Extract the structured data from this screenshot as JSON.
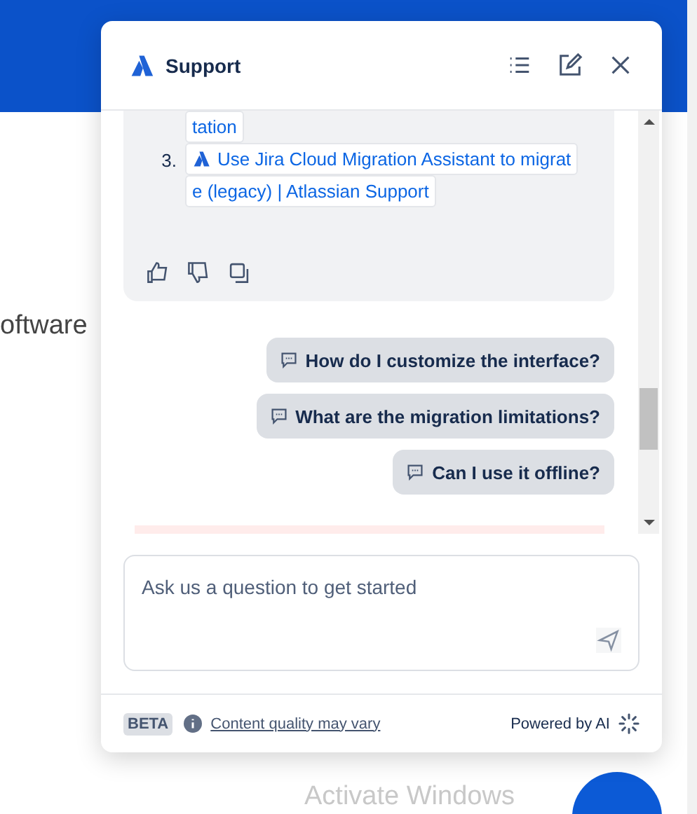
{
  "background_page": {
    "text_fragment": "oftware"
  },
  "panel": {
    "title": "Support",
    "sources": [
      {
        "has_logo": false,
        "lines": [
          "tation"
        ]
      },
      {
        "number": "3.",
        "has_logo": true,
        "lines": [
          "Use Jira Cloud Migration Assistant to migrat",
          "e (legacy) | Atlassian Support"
        ]
      }
    ],
    "suggestions": [
      "How do I customize the interface?",
      "What are the migration limitations?",
      "Can I use it offline?"
    ],
    "input": {
      "placeholder": "Ask us a question to get started"
    },
    "footer": {
      "badge": "BETA",
      "disclaimer": "Content quality may vary",
      "powered": "Powered by AI"
    }
  },
  "os_watermark": "Activate Windows"
}
